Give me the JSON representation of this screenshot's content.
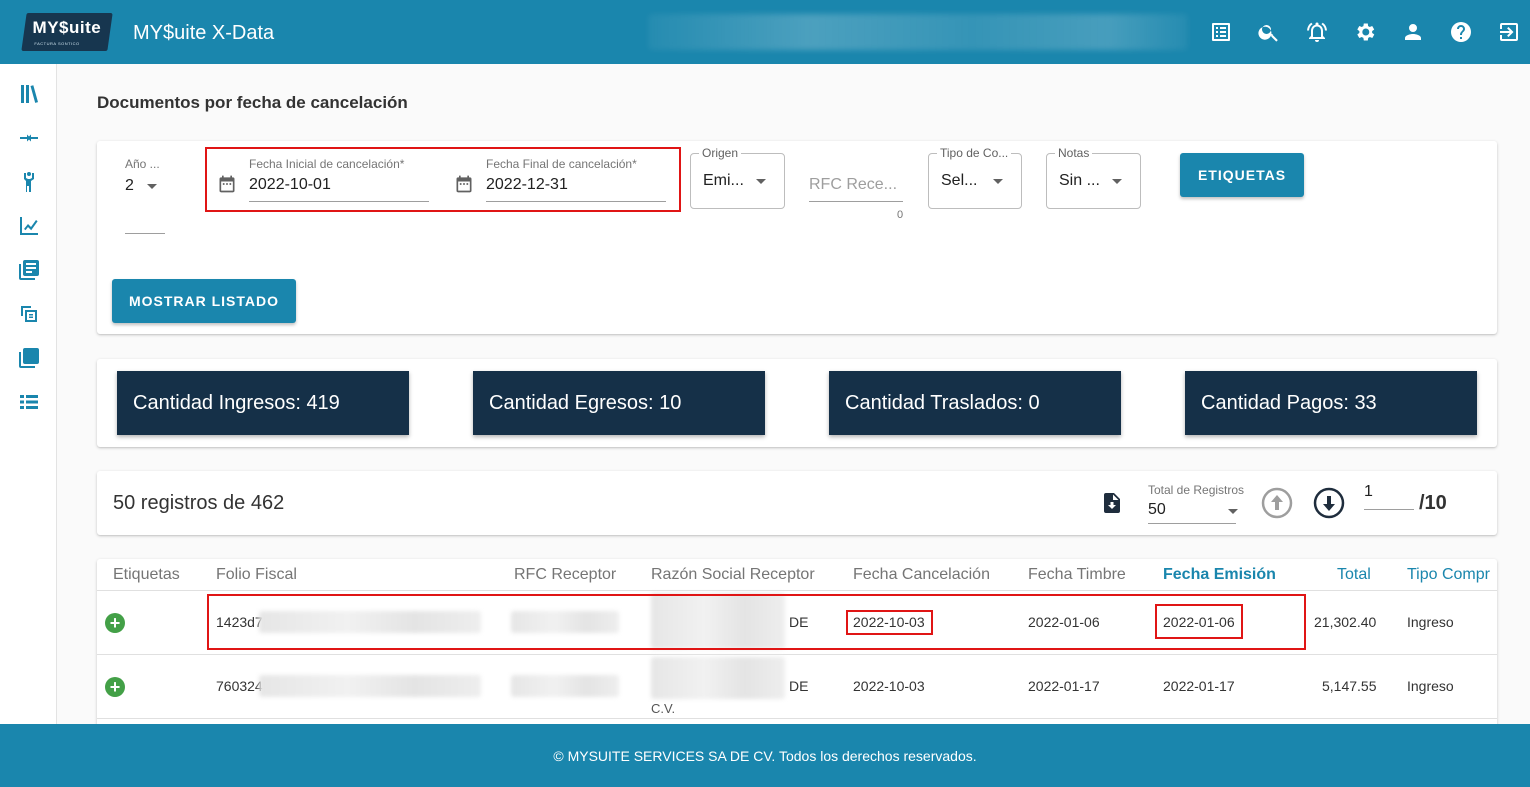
{
  "header": {
    "logo_text": "MY$uite",
    "logo_sub": "FACTURA SONTICO",
    "app_title": "MY$uite X-Data",
    "icons": [
      "list-alt-icon",
      "search-icon",
      "notifications-icon",
      "settings-icon",
      "account-icon",
      "help-icon",
      "logout-icon"
    ]
  },
  "sidebar": {
    "icons": [
      "library-icon",
      "compare-arrows-icon",
      "person-icon",
      "chart-icon",
      "documents-icon",
      "copy-icon",
      "layers-icon",
      "list-icon"
    ]
  },
  "page": {
    "title": "Documentos por fecha de cancelación"
  },
  "filters": {
    "year_label": "Año ...",
    "year_value": "2",
    "start_date_label": "Fecha Inicial de cancelación*",
    "start_date_value": "2022-10-01",
    "end_date_label": "Fecha Final de cancelación*",
    "end_date_value": "2022-12-31",
    "origen_label": "Origen",
    "origen_value": "Emi...",
    "rfc_placeholder": "RFC Rece...",
    "rfc_counter": "0",
    "tipo_label": "Tipo de Co...",
    "tipo_value": "Sel...",
    "notas_label": "Notas",
    "notas_value": "Sin ...",
    "etiquetas_button": "ETIQUETAS",
    "mostrar_button": "MOSTRAR LISTADO"
  },
  "stats": [
    {
      "label": "Cantidad Ingresos: 419"
    },
    {
      "label": "Cantidad Egresos: 10"
    },
    {
      "label": "Cantidad Traslados: 0"
    },
    {
      "label": "Cantidad Pagos: 33"
    }
  ],
  "pager": {
    "records_text": "50 registros de 462",
    "total_label": "Total de Registros",
    "total_value": "50",
    "page_value": "1",
    "page_total": "/10"
  },
  "table": {
    "headers": [
      "Etiquetas",
      "Folio Fiscal",
      "RFC Receptor",
      "Razón Social Receptor",
      "Fecha Cancelación",
      "Fecha Timbre",
      "Fecha Emisión",
      "Total",
      "Tipo Compr"
    ],
    "rows": [
      {
        "folio": "1423d7",
        "razon_tail": "DE",
        "razon_extra": "",
        "fecha_cancelacion": "2022-10-03",
        "fecha_timbre": "2022-01-06",
        "fecha_emision": "2022-01-06",
        "total": "21,302.40",
        "tipo": "Ingreso"
      },
      {
        "folio": "760324",
        "razon_tail": "DE",
        "razon_extra": "C.V.",
        "fecha_cancelacion": "2022-10-03",
        "fecha_timbre": "2022-01-17",
        "fecha_emision": "2022-01-17",
        "total": "5,147.55",
        "tipo": "Ingreso"
      }
    ]
  },
  "footer": {
    "text": "© MYSUITE SERVICES SA DE CV. Todos los derechos reservados."
  },
  "colors": {
    "primary": "#1a86ad",
    "tile": "#153048",
    "highlight": "#e01515",
    "add": "#43a047"
  }
}
